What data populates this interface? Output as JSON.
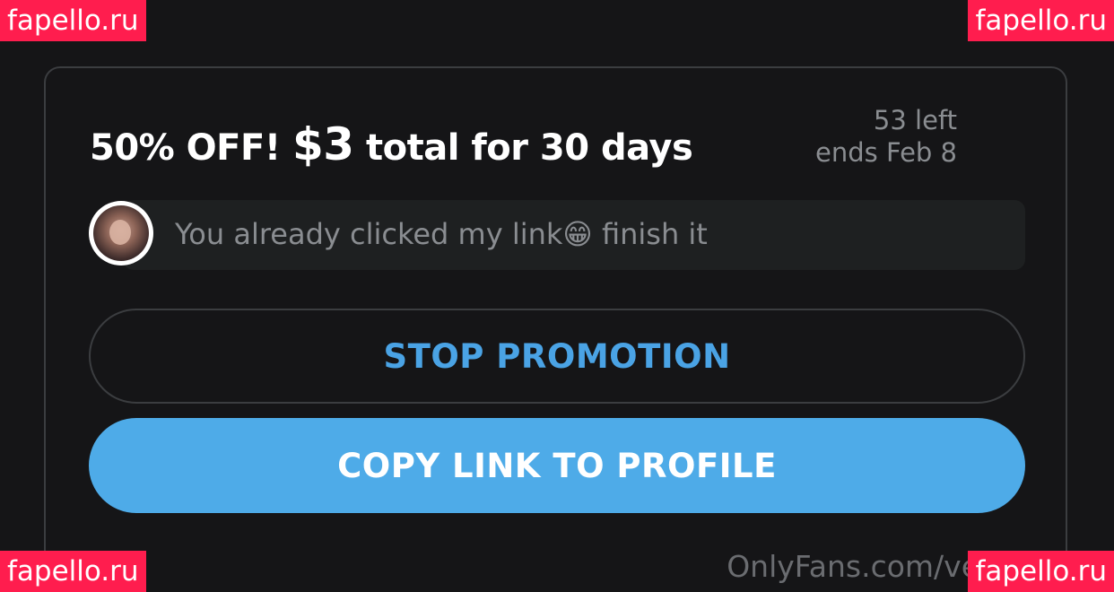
{
  "promotion": {
    "headline_prefix": "50% OFF! ",
    "headline_price": "$3",
    "headline_suffix": " total for 30 days",
    "remaining": "53 left",
    "ends": "ends Feb 8",
    "message": "You already clicked my link😁 finish it"
  },
  "actions": {
    "stop_label": "STOP PROMOTION",
    "copy_label": "COPY LINK TO PROFILE"
  },
  "watermarks": {
    "top_left": "fapello.ru",
    "top_right": "fapello.ru",
    "bottom_left": "fapello.ru",
    "bottom_right": "fapello.ru",
    "footer": "OnlyFans.com/ve"
  },
  "colors": {
    "background": "#151517",
    "accent": "#4eabe8",
    "accent_text": "#4aa3e5",
    "watermark": "#ff1d4e",
    "muted_text": "#8a8d91"
  }
}
